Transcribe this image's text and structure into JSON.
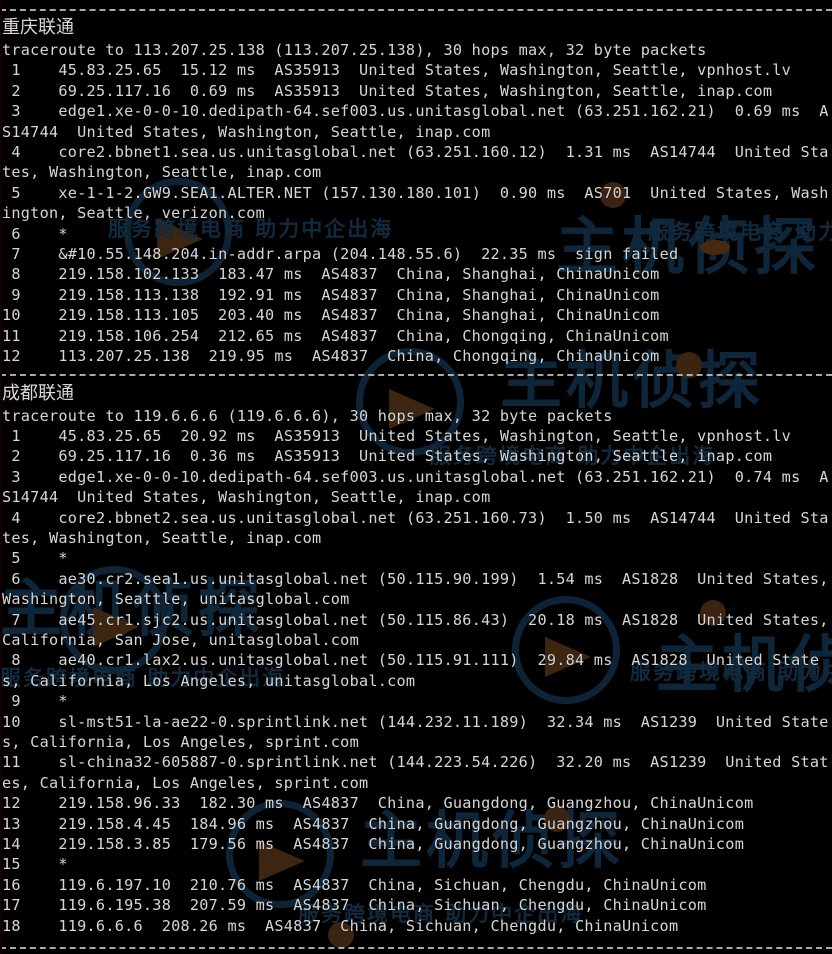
{
  "terminal": {
    "background_color": "#000000",
    "text_color": "#d6d6d6",
    "separator_color": "#c7c7c7",
    "watermark_color": "#0d2238"
  },
  "watermark": {
    "brand_big": "主机侦探",
    "brand_tagline": "服务跨境电商 助力中企出海"
  },
  "separators": {
    "top": "----------------------------------------------------------------------------------------",
    "middle": "----------------------------------------------------------------------------------------",
    "bottom": "----------------------------------------------------------------------------------------"
  },
  "sections": [
    {
      "title": "重庆联通",
      "header": "traceroute to 113.207.25.138 (113.207.25.138), 30 hops max, 32 byte packets",
      "hops": [
        " 1    45.83.25.65  15.12 ms  AS35913  United States, Washington, Seattle, vpnhost.lv",
        " 2    69.25.117.16  0.69 ms  AS35913  United States, Washington, Seattle, inap.com",
        " 3    edge1.xe-0-0-10.dedipath-64.sef003.us.unitasglobal.net (63.251.162.21)  0.69 ms  AS14744  United States, Washington, Seattle, inap.com",
        " 4    core2.bbnet1.sea.us.unitasglobal.net (63.251.160.12)  1.31 ms  AS14744  United States, Washington, Seattle, inap.com",
        " 5    xe-1-1-2.GW9.SEA1.ALTER.NET (157.130.180.101)  0.90 ms  AS701  United States, Washington, Seattle, verizon.com",
        " 6    *",
        " 7    &#10.55.148.204.in-addr.arpa (204.148.55.6)  22.35 ms  sign failed",
        " 8    219.158.102.133  183.47 ms  AS4837  China, Shanghai, ChinaUnicom",
        " 9    219.158.113.138  192.91 ms  AS4837  China, Shanghai, ChinaUnicom",
        "10    219.158.113.105  203.40 ms  AS4837  China, Shanghai, ChinaUnicom",
        "11    219.158.106.254  212.65 ms  AS4837  China, Chongqing, ChinaUnicom",
        "12    113.207.25.138  219.95 ms  AS4837  China, Chongqing, ChinaUnicom"
      ]
    },
    {
      "title": "成都联通",
      "header": "traceroute to 119.6.6.6 (119.6.6.6), 30 hops max, 32 byte packets",
      "hops": [
        " 1    45.83.25.65  20.92 ms  AS35913  United States, Washington, Seattle, vpnhost.lv",
        " 2    69.25.117.16  0.36 ms  AS35913  United States, Washington, Seattle, inap.com",
        " 3    edge1.xe-0-0-10.dedipath-64.sef003.us.unitasglobal.net (63.251.162.21)  0.74 ms  AS14744  United States, Washington, Seattle, inap.com",
        " 4    core2.bbnet2.sea.us.unitasglobal.net (63.251.160.73)  1.50 ms  AS14744  United States, Washington, Seattle, inap.com",
        " 5    *",
        " 6    ae30.cr2.sea1.us.unitasglobal.net (50.115.90.199)  1.54 ms  AS1828  United States, Washington, Seattle, unitasglobal.com",
        " 7    ae45.cr1.sjc2.us.unitasglobal.net (50.115.86.43)  20.18 ms  AS1828  United States, California, San Jose, unitasglobal.com",
        " 8    ae40.cr1.lax2.us.unitasglobal.net (50.115.91.111)  29.84 ms  AS1828  United States, California, Los Angeles, unitasglobal.com",
        " 9    *",
        "10    sl-mst51-la-ae22-0.sprintlink.net (144.232.11.189)  32.34 ms  AS1239  United States, California, Los Angeles, sprint.com",
        "11    sl-china32-605887-0.sprintlink.net (144.223.54.226)  32.20 ms  AS1239  United States, California, Los Angeles, sprint.com",
        "12    219.158.96.33  182.30 ms  AS4837  China, Guangdong, Guangzhou, ChinaUnicom",
        "13    219.158.4.45  184.96 ms  AS4837  China, Guangdong, Guangzhou, ChinaUnicom",
        "14    219.158.3.85  179.56 ms  AS4837  China, Guangdong, Guangzhou, ChinaUnicom",
        "15    *",
        "16    119.6.197.10  210.76 ms  AS4837  China, Sichuan, Chengdu, ChinaUnicom",
        "17    119.6.195.38  207.59 ms  AS4837  China, Sichuan, Chengdu, ChinaUnicom",
        "18    119.6.6.6  208.26 ms  AS4837  China, Sichuan, Chengdu, ChinaUnicom"
      ]
    }
  ]
}
